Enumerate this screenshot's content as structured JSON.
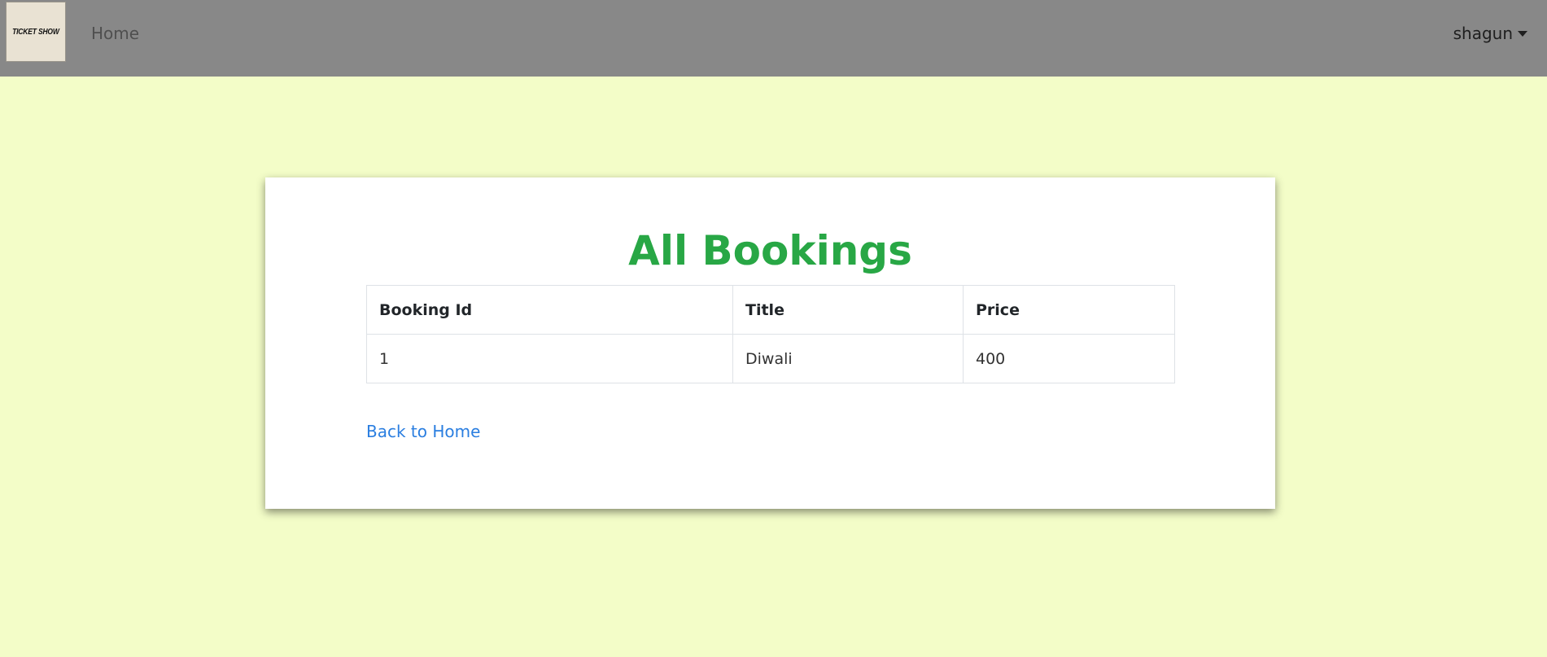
{
  "navbar": {
    "logo_text": "TICKET SHOW",
    "home_label": "Home",
    "user_name": "shagun"
  },
  "main": {
    "title": "All Bookings",
    "table": {
      "headers": [
        "Booking Id",
        "Title",
        "Price"
      ],
      "rows": [
        [
          "1",
          "Diwali",
          "400"
        ]
      ]
    },
    "back_link": "Back to Home"
  },
  "colors": {
    "page_background": "#f3fdc8",
    "navbar_background": "#888888",
    "title_color": "#28a745",
    "link_color": "#2a7ee0"
  }
}
